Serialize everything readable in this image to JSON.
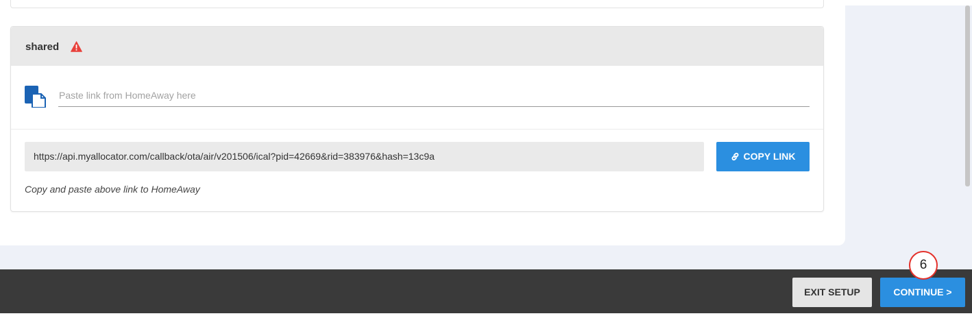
{
  "panel": {
    "title": "shared",
    "warning_icon": "warning-triangle-icon",
    "paste_icon": "paste-clipboard-icon",
    "paste_placeholder": "Paste link from HomeAway here",
    "paste_value": "",
    "export_url": "https://api.myallocator.com/callback/ota/air/v201506/ical?pid=42669&rid=383976&hash=13c9a",
    "copy_button_label": "COPY LINK",
    "copy_icon": "link-icon",
    "copy_hint": "Copy and paste above link to HomeAway"
  },
  "footer": {
    "exit_label": "EXIT SETUP",
    "continue_label": "CONTINUE >"
  },
  "step_marker": "6",
  "colors": {
    "accent": "#2b8fe0",
    "warning": "#e8413b",
    "footer": "#3a3a3a",
    "header": "#e9e9e9"
  }
}
